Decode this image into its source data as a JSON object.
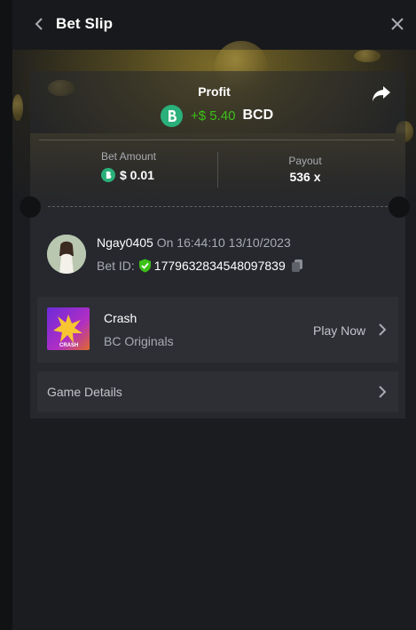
{
  "header": {
    "title": "Bet Slip"
  },
  "profit": {
    "label": "Profit",
    "value": "+$ 5.40",
    "currency": "BCD"
  },
  "bet_amount": {
    "label": "Bet Amount",
    "value": "$ 0.01"
  },
  "payout": {
    "label": "Payout",
    "value": "536 x"
  },
  "user": {
    "name": "Ngay0405",
    "timestamp": "On 16:44:10 13/10/2023",
    "bet_id_label": "Bet ID:",
    "bet_id": "1779632834548097839"
  },
  "game": {
    "name": "Crash",
    "provider": "BC Originals",
    "play_label": "Play Now",
    "thumb_text": "CRASH"
  },
  "details": {
    "label": "Game Details"
  },
  "colors": {
    "accent_green": "#3bc117",
    "bc_green": "#2ab07a",
    "panel_bg": "#1b1c20"
  },
  "icons": [
    "chevron-left-icon",
    "close-icon",
    "share-icon",
    "bc-coin-icon",
    "verified-shield-icon",
    "copy-icon",
    "chevron-right-icon"
  ]
}
